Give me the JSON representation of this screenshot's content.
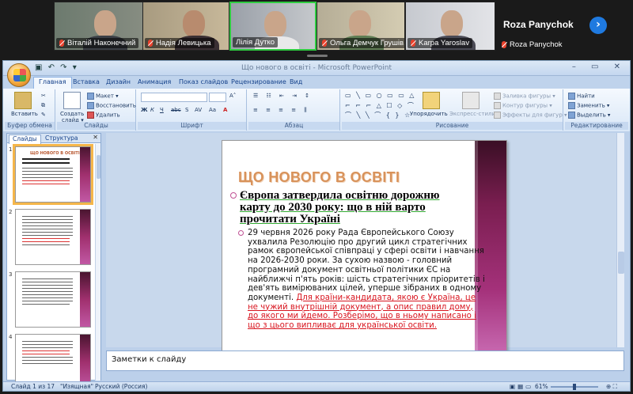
{
  "meeting": {
    "participants": [
      {
        "name": "Віталій Наконечний"
      },
      {
        "name": "Надія Левицька"
      },
      {
        "name": "Лілія Дутко"
      },
      {
        "name": "Ольга Демчук Грушів..."
      },
      {
        "name": "Karpa Yaroslav"
      }
    ],
    "featured_name": "Roza Panychok",
    "featured_tag": "Roza Panychok",
    "next_icon": "chevron-right-icon"
  },
  "powerpoint": {
    "window_title": "Що нового в освіті - Microsoft PowerPoint",
    "quick_access": "▣ ↶ ↷ ▾",
    "window_controls": "– ▭ ✕",
    "tabs": [
      "Главная",
      "Вставка",
      "Дизайн",
      "Анимация",
      "Показ слайдов",
      "Рецензирование",
      "Вид"
    ],
    "ribbon": {
      "clipboard": {
        "paste": "Вставить",
        "label": "Буфер обмена"
      },
      "slides": {
        "create": "Создать",
        "create2": "слайд ▾",
        "layout": "Макет ▾",
        "reset": "Восстановить",
        "delete": "Удалить",
        "label": "Слайды"
      },
      "font": {
        "bold": "Ж",
        "italic": "К",
        "underline": "Ч",
        "strike": "abc",
        "shadow": "S",
        "spacing": "AV",
        "case": "Aa",
        "color": "A",
        "label": "Шрифт"
      },
      "paragraph": {
        "label": "Абзац"
      },
      "drawing": {
        "arrange": "Упорядочить",
        "styles": "Экспресс-стили",
        "fill": "Заливка фигуры ▾",
        "outline": "Контур фигуры ▾",
        "effects": "Эффекты для фигур ▾",
        "label": "Рисование"
      },
      "editing": {
        "find": "Найти",
        "replace": "Заменить ▾",
        "select": "Выделить ▾",
        "label": "Редактирование"
      }
    },
    "panel_tabs": [
      "Слайды",
      "Структура"
    ],
    "panel_close": "✕",
    "thumbnails": [
      {
        "num": "1",
        "title": "ЩО НОВОГО В ОСВІТІ"
      },
      {
        "num": "2",
        "title": ""
      },
      {
        "num": "3",
        "title": ""
      },
      {
        "num": "4",
        "title": ""
      }
    ],
    "slide": {
      "title": "ЩО НОВОГО В ОСВІТІ",
      "bullet1": "Європа затвердила освітню дорожню карту до 2030 року: що в ній варто прочитати Україні",
      "bullet2_black": "29 червня 2026 року Рада Європейського Союзу ухвалила Резолюцію про другий цикл стратегічних рамок європейської співпраці у сфері освіти і навчання на 2026-2030 роки. За сухою назвою - головний програмний документ освітньої політики ЄС на найближчі п'ять років: шість стратегічних пріоритетів і дев'ять вимірюваних цілей, уперше зібраних в одному документі. ",
      "bullet2_red": "Для країни-кандидата, якою є Україна, це не чужий внутрішній документ, а опис правил дому, до якого ми йдемо. Розберімо, що в ньому написано і що з цього випливає для української освіти."
    },
    "notes_placeholder": "Заметки к слайду",
    "status": {
      "slide_counter": "Слайд 1 из 17",
      "theme": "\"Изящная\"",
      "language": "Русский (Россия)",
      "zoom": "61%",
      "zoom_fraction": 0.61
    }
  }
}
